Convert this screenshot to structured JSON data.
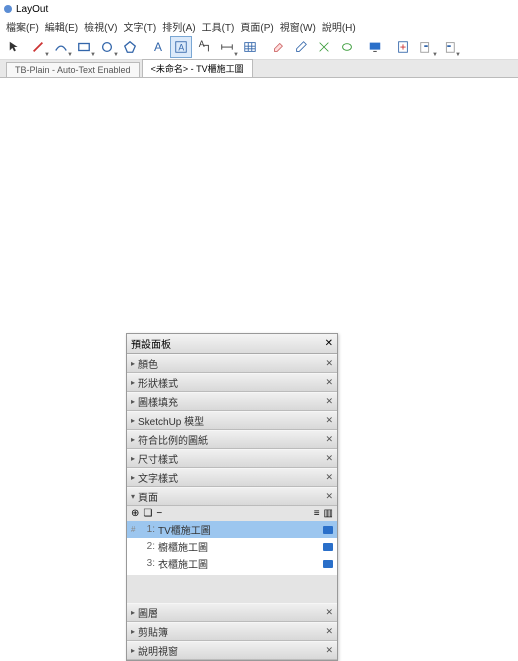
{
  "app": {
    "title": "LayOut"
  },
  "menu": [
    "檔案(F)",
    "編輯(E)",
    "檢視(V)",
    "文字(T)",
    "排列(A)",
    "工具(T)",
    "頁面(P)",
    "視窗(W)",
    "說明(H)"
  ],
  "tabs": {
    "inactive": "TB-Plain - Auto-Text Enabled",
    "active": "<未命名> - TV櫃施工圖"
  },
  "panel": {
    "title": "預設面板",
    "sections": [
      "顏色",
      "形狀樣式",
      "圖樣填充",
      "SketchUp 模型",
      "符合比例的圖紙",
      "尺寸樣式",
      "文字樣式"
    ],
    "pagesLabel": "頁面",
    "pages": [
      {
        "n": "1:",
        "name": "TV櫃施工圖",
        "sel": true,
        "ic": true
      },
      {
        "n": "2:",
        "name": "櫥櫃施工圖",
        "sel": false,
        "ic": false
      },
      {
        "n": "3:",
        "name": "衣櫃施工圖",
        "sel": false,
        "ic": false
      }
    ],
    "bottom": [
      "圖層",
      "剪貼簿",
      "說明視窗"
    ]
  },
  "icons": {
    "select": "↖",
    "pencil": "✎",
    "arc": "⌒",
    "rect": "▭",
    "circle": "○",
    "poly": "⬠",
    "textA": "A",
    "textBox": "A",
    "label": "A┐",
    "dim": "⟷",
    "table": "▦",
    "erase": "❏",
    "eyedrop": "💧",
    "bucket": "⟋",
    "split": "⤢",
    "join": "⤡",
    "monitor": "🖥",
    "add": "⊞",
    "mode1": "▭",
    "mode2": "◫",
    "plus": "+",
    "minus": "−",
    "list": "≡",
    "grid": "▥"
  }
}
